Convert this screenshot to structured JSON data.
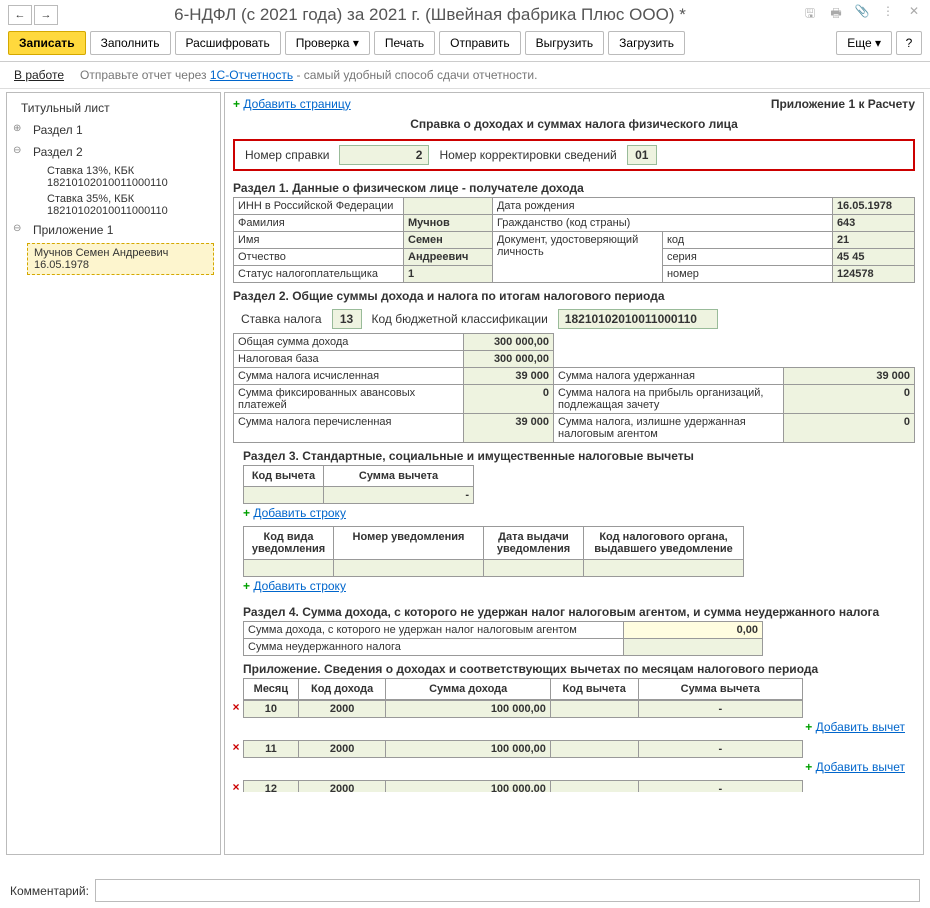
{
  "titlebar": {
    "title": "6-НДФЛ (с 2021 года) за 2021 г. (Швейная фабрика Плюс ООО) *"
  },
  "toolbar": {
    "write": "Записать",
    "fill": "Заполнить",
    "decode": "Расшифровать",
    "check": "Проверка",
    "print": "Печать",
    "send": "Отправить",
    "export": "Выгрузить",
    "import": "Загрузить",
    "more": "Еще",
    "help": "?"
  },
  "infobar": {
    "inwork": "В работе",
    "text_before": "Отправьте отчет через ",
    "link": "1С-Отчетность",
    "text_after": " - самый удобный способ сдачи отчетности."
  },
  "sidebar": {
    "title_sheet": "Титульный лист",
    "sect1": "Раздел 1",
    "sect2": "Раздел 2",
    "rate13": "Ставка 13%, КБК",
    "kbk13": "18210102010011000110",
    "rate35": "Ставка 35%, КБК",
    "kbk35": "18210102010011000110",
    "attach1": "Приложение 1",
    "person": "Мучнов Семен Андреевич",
    "person_date": "16.05.1978"
  },
  "content": {
    "add_page": "Добавить страницу",
    "attach_title": "Приложение 1 к Расчету",
    "doc_title": "Справка о доходах и суммах налога физического лица",
    "ref_num_label": "Номер справки",
    "ref_num": "2",
    "corr_label": "Номер корректировки сведений",
    "corr_num": "01"
  },
  "sect1": {
    "head": "Раздел 1. Данные о физическом лице - получателе дохода",
    "inn_label": "ИНН в Российской Федерации",
    "inn": "",
    "dob_label": "Дата рождения",
    "dob": "16.05.1978",
    "lname_label": "Фамилия",
    "lname": "Мучнов",
    "citiz_label": "Гражданство (код страны)",
    "citiz": "643",
    "fname_label": "Имя",
    "fname": "Семен",
    "doc_label": "Документ, удостоверяющий личность",
    "code_label": "код",
    "code": "21",
    "mname_label": "Отчество",
    "mname": "Андреевич",
    "series_label": "серия",
    "series": "45 45",
    "status_label": "Статус налогоплательщика",
    "status": "1",
    "num_label": "номер",
    "num": "124578"
  },
  "sect2": {
    "head": "Раздел 2. Общие суммы дохода и налога по итогам налогового периода",
    "rate_label": "Ставка налога",
    "rate": "13",
    "kbk_label": "Код бюджетной классификации",
    "kbk": "18210102010011000110",
    "total_income_label": "Общая сумма дохода",
    "total_income": "300 000,00",
    "tax_base_label": "Налоговая база",
    "tax_base": "300 000,00",
    "tax_calc_label": "Сумма налога исчисленная",
    "tax_calc": "39 000",
    "tax_held_label": "Сумма налога удержанная",
    "tax_held": "39 000",
    "fixed_adv_label": "Сумма фиксированных авансовых платежей",
    "fixed_adv": "0",
    "profit_tax_label": "Сумма налога на прибыль организаций, подлежащая зачету",
    "profit_tax": "0",
    "tax_paid_label": "Сумма налога перечисленная",
    "tax_paid": "39 000",
    "tax_excess_label": "Сумма налога, излишне удержанная налоговым агентом",
    "tax_excess": "0"
  },
  "sect3": {
    "head": "Раздел 3. Стандартные, социальные и имущественные налоговые вычеты",
    "code_h": "Код вычета",
    "sum_h": "Сумма вычета",
    "add_row": "Добавить строку",
    "notif_type_h": "Код вида уведомления",
    "notif_num_h": "Номер уведомления",
    "notif_date_h": "Дата выдачи уведомления",
    "notif_org_h": "Код налогового органа, выдавшего уведомление"
  },
  "sect4": {
    "head": "Раздел 4. Сумма дохода, с которого не удержан налог налоговым агентом, и сумма неудержанного налога",
    "row1": "Сумма дохода, с которого не удержан налог налоговым агентом",
    "val1": "0,00",
    "row2": "Сумма неудержанного налога",
    "val2": ""
  },
  "attach": {
    "head": "Приложение. Сведения о доходах и соответствующих вычетах по месяцам налогового периода",
    "month_h": "Месяц",
    "inc_code_h": "Код дохода",
    "inc_sum_h": "Сумма дохода",
    "ded_code_h": "Код вычета",
    "ded_sum_h": "Сумма вычета",
    "add_deduct": "Добавить вычет",
    "rows": [
      {
        "month": "10",
        "code": "2000",
        "sum": "100 000,00"
      },
      {
        "month": "11",
        "code": "2000",
        "sum": "100 000,00"
      },
      {
        "month": "12",
        "code": "2000",
        "sum": "100 000,00"
      }
    ]
  },
  "footer": {
    "comment_label": "Комментарий:"
  }
}
